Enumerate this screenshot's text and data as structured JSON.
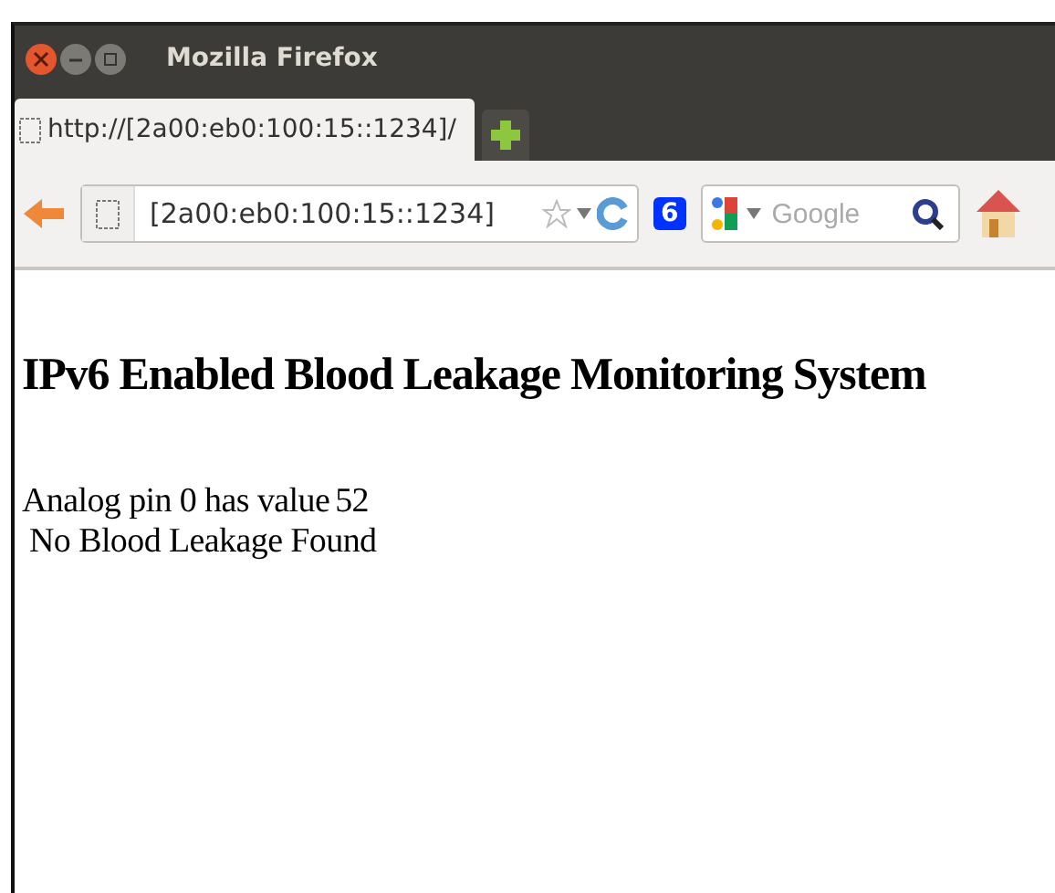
{
  "window": {
    "title": "Mozilla Firefox"
  },
  "tabs": [
    {
      "label": "http://[2a00:eb0:100:15::1234]/",
      "selected": true
    }
  ],
  "toolbar": {
    "url": "[2a00:eb0:100:15::1234]",
    "ipv6_badge": "6",
    "search": {
      "placeholder": "Google"
    }
  },
  "page": {
    "heading": "IPv6 Enabled Blood Leakage Monitoring System",
    "reading_label": "Analog pin 0 has value",
    "reading_value": "52",
    "status": "No Blood Leakage Found"
  }
}
